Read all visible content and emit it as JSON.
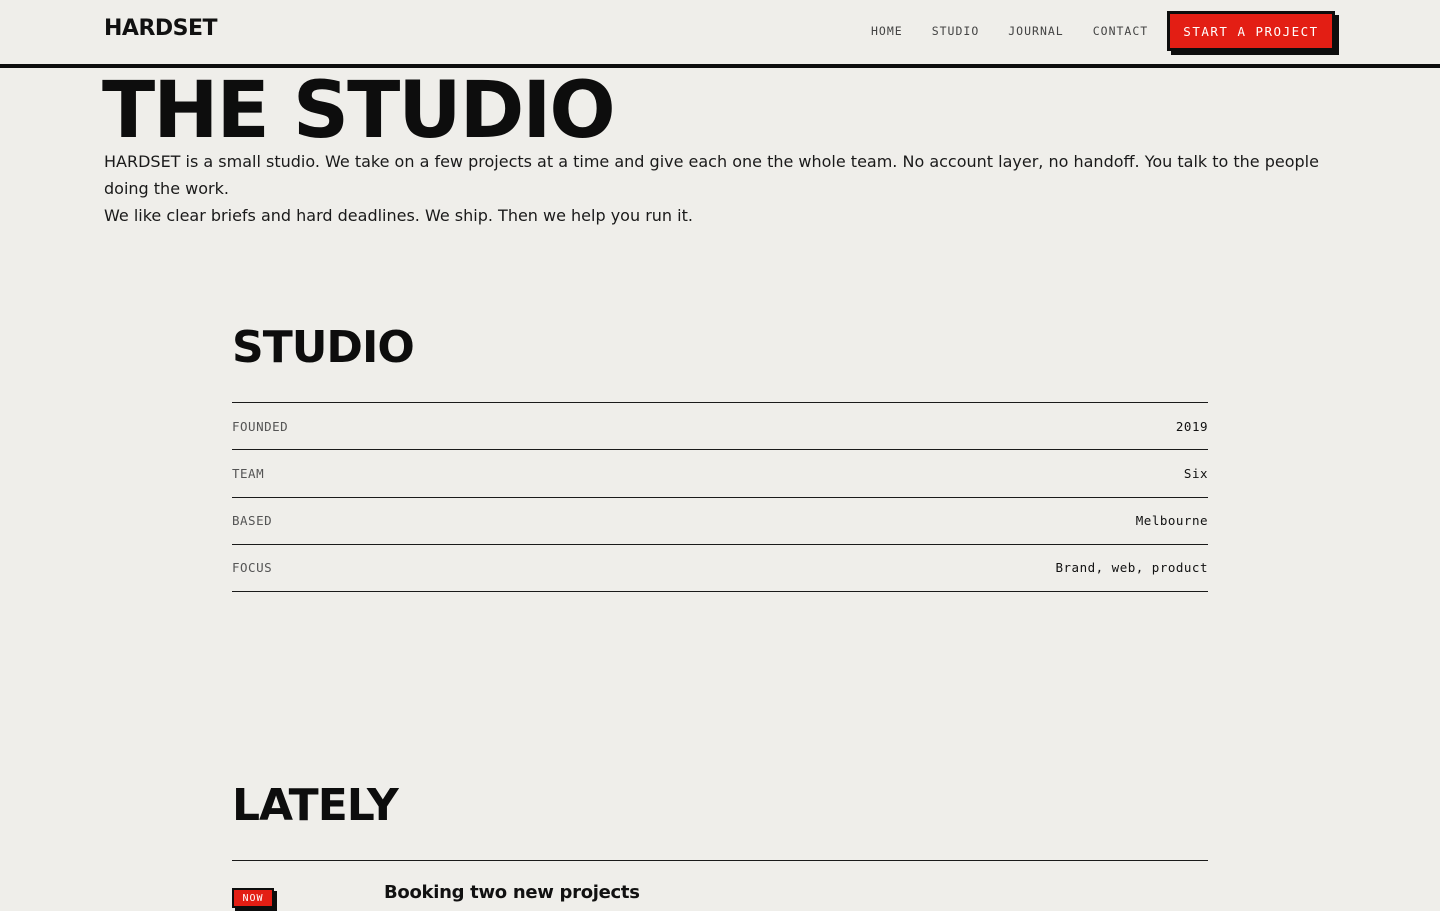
{
  "header": {
    "logo": "HARDSET",
    "nav": [
      "HOME",
      "STUDIO",
      "JOURNAL",
      "CONTACT"
    ],
    "cta_label": "START A PROJECT"
  },
  "hero": {
    "title": "THE STUDIO",
    "paragraphs": [
      "HARDSET is a small studio. We take on a few projects at a time and give each one the whole team. No account layer, no handoff. You talk to the people doing the work.",
      "We like clear briefs and hard deadlines. We ship. Then we help you run it."
    ]
  },
  "studio": {
    "title": "STUDIO",
    "facts": [
      {
        "label": "FOUNDED",
        "value": "2019"
      },
      {
        "label": "TEAM",
        "value": "Six"
      },
      {
        "label": "BASED",
        "value": "Melbourne"
      },
      {
        "label": "FOCUS",
        "value": "Brand, web, product"
      }
    ]
  },
  "lately": {
    "title": "LATELY",
    "items": [
      {
        "badge": "NOW",
        "title": "Booking two new projects"
      }
    ]
  },
  "colors": {
    "background": "#efeeea",
    "accent": "#e31e14",
    "ink": "#0d0d0d"
  }
}
